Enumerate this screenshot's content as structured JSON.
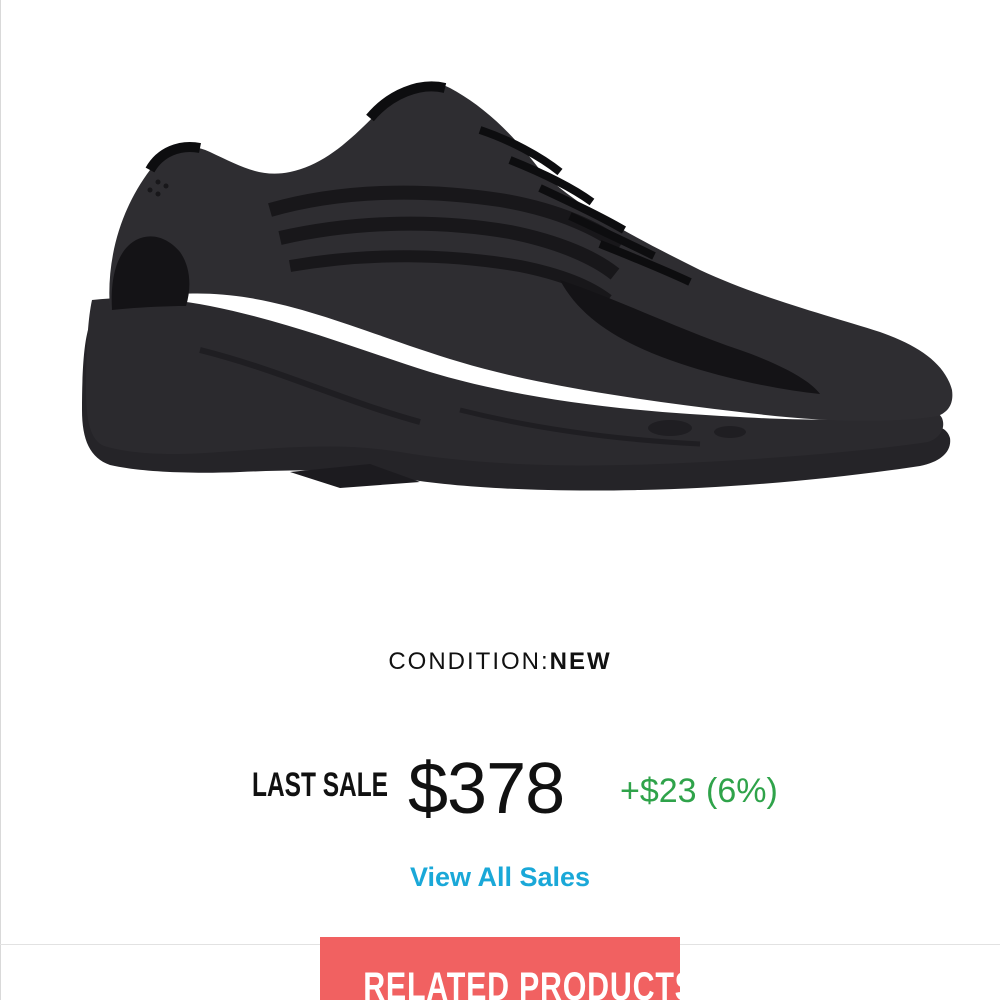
{
  "product": {
    "image_alt": "sneaker product image",
    "condition_label": "CONDITION:",
    "condition_value": "NEW"
  },
  "sale": {
    "label": "LAST SALE",
    "price": "$378",
    "change": "+$23 (6%)",
    "view_all": "View All Sales"
  },
  "related": {
    "tab_label": "RELATED PRODUCTS"
  },
  "colors": {
    "price_change": "#2fa34a",
    "link": "#1aa8d8",
    "related_tab": "#f16161",
    "sneaker": "#2e2d31"
  }
}
